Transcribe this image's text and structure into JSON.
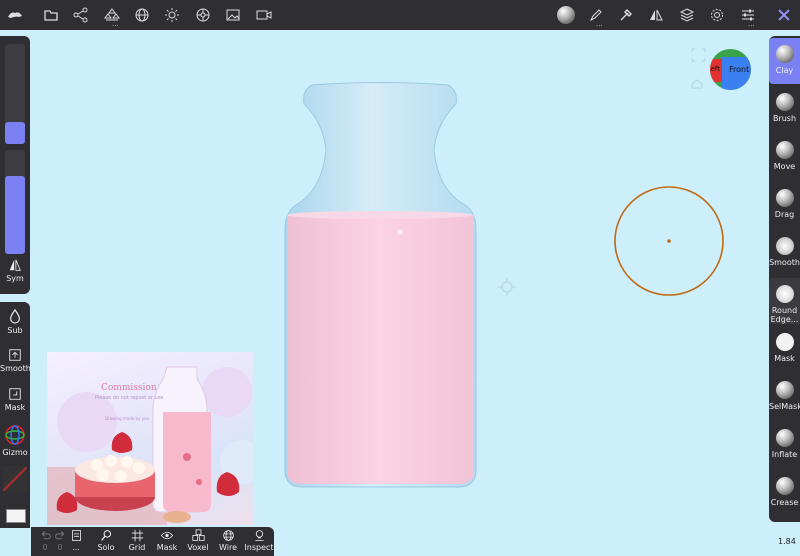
{
  "top_toolbar": {
    "left_icons": [
      "menu-logo-icon",
      "folder-icon",
      "share-nodes-icon",
      "scene-tree-icon",
      "globe-icon",
      "sun-icon",
      "material-sphere-icon",
      "image-icon",
      "camera-icon"
    ],
    "right_icons": [
      "matcap-sphere-icon",
      "paint-brush-icon",
      "pipette-icon",
      "symmetry-icon",
      "layers-icon",
      "settings-gear-icon",
      "sliders-icon",
      "tools-x-icon"
    ]
  },
  "left_sidebar": {
    "radius_slider": {
      "value": 0.22
    },
    "intensity_slider": {
      "value": 0.75
    },
    "sym_label": "Sym",
    "sub_label": "Sub",
    "smooth_label": "Smooth",
    "mask_label": "Mask",
    "gizmo_label": "Gizmo"
  },
  "bottom_toolbar": {
    "items": [
      {
        "label": "",
        "icon": "undo-icon"
      },
      {
        "label": "",
        "icon": "redo-icon"
      },
      {
        "label": "...",
        "icon": "history-list-icon"
      },
      {
        "label": "Solo",
        "icon": "solo-search-icon"
      },
      {
        "label": "Grid",
        "icon": "grid-icon"
      },
      {
        "label": "Mask",
        "icon": "eye-icon"
      },
      {
        "label": "Voxel",
        "icon": "voxel-cubes-icon"
      },
      {
        "label": "Wire",
        "icon": "wire-globe-icon"
      },
      {
        "label": "Inspect",
        "icon": "inspect-icon"
      }
    ],
    "undo_count": "0",
    "redo_count": "0"
  },
  "right_sidebar": {
    "tools": [
      {
        "label": "Clay",
        "active": true
      },
      {
        "label": "Brush",
        "active": false
      },
      {
        "label": "Move",
        "active": false
      },
      {
        "label": "Drag",
        "active": false
      },
      {
        "label": "Smooth",
        "active": false
      },
      {
        "label": "Round Edge...",
        "active": false
      },
      {
        "label": "Mask",
        "active": false
      },
      {
        "label": "SelMask",
        "active": false
      },
      {
        "label": "Inflate",
        "active": false
      },
      {
        "label": "Crease",
        "active": false
      }
    ]
  },
  "orientation_cube": {
    "front_label": "Front",
    "left_label": "Left"
  },
  "reference_image": {
    "title": "Commission",
    "subtitle": "Please do not repost or use",
    "caption": "Drawing made by you"
  },
  "zoom_level": "1.84",
  "colors": {
    "accent": "#7b80f2",
    "panel": "#2e2e33",
    "viewport": "#cdeefb",
    "brush_cursor": "#c06a10",
    "liquid": "#f6c9dc"
  }
}
